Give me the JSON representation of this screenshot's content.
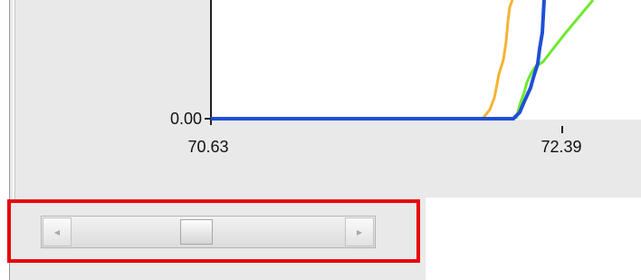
{
  "plot": {
    "y_tick_label": "0.00",
    "x_tick_labels": [
      "70.63",
      "72.39"
    ],
    "x_range": [
      70.63,
      72.39
    ],
    "y_baseline": 0.0,
    "series_colors": {
      "blue": "#1f4fd6",
      "orange": "#f5b335",
      "green": "#6ee830"
    }
  },
  "scrollbar": {
    "left_arrow_icon": "◂",
    "right_arrow_icon": "▸",
    "thumb_position_fraction": 0.45
  },
  "highlight": {
    "color": "#e8060b"
  }
}
